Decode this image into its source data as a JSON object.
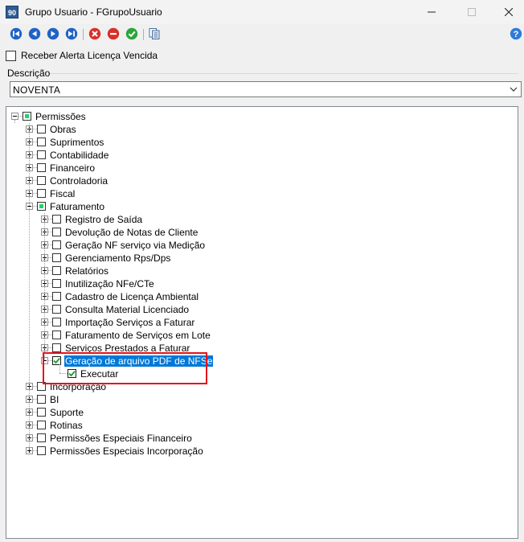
{
  "window": {
    "app_icon": "90",
    "title": "Grupo Usuario - FGrupoUsuario",
    "controls": [
      "minimize-icon",
      "maximize-icon",
      "close-icon"
    ]
  },
  "toolbar": {
    "buttons": [
      "first-record-icon",
      "previous-record-icon",
      "next-record-icon",
      "last-record-icon",
      "cancel-icon",
      "delete-icon",
      "confirm-icon",
      "copy-icon",
      "help-icon"
    ]
  },
  "alert_checkbox": {
    "label": "Receber Alerta Licença Vencida",
    "checked": false
  },
  "description": {
    "label": "Descrição",
    "value": "NOVENTA"
  },
  "tree": {
    "root": "Permissões",
    "l1_before": [
      "Obras",
      "Suprimentos",
      "Contabilidade",
      "Financeiro",
      "Controladoria",
      "Fiscal"
    ],
    "faturamento": "Faturamento",
    "faturamento_children": [
      "Registro de Saída",
      "Devolução de Notas de Cliente",
      "Geração NF serviço via Medição",
      "Gerenciamento Rps/Dps",
      "Relatórios",
      "Inutilização NFe/CTe",
      "Cadastro de Licença Ambiental",
      "Consulta Material Licenciado",
      "Importação Serviços a Faturar",
      "Faturamento de Serviços em Lote",
      "Serviços Prestados a Faturar"
    ],
    "selected_node": "Geração de arquivo PDF de NFSe",
    "selected_child": "Executar",
    "l1_after": [
      "Incorporação",
      "BI",
      "Suporte",
      "Rotinas",
      "Permissões Especiais Financeiro",
      "Permissões Especiais Incorporação"
    ]
  },
  "colors": {
    "selection": "#0078d7",
    "highlight_box": "#e2141c",
    "partial_check": "#1fd46a",
    "check_mark": "#1a9b2f"
  }
}
